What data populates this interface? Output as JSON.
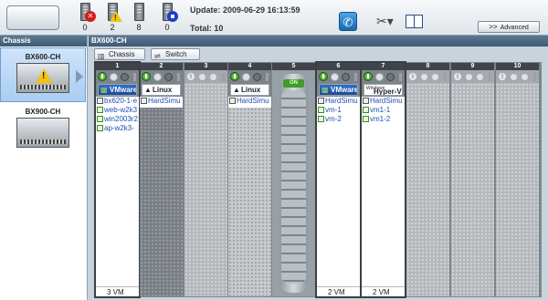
{
  "toolbar": {
    "counts": {
      "error": "0",
      "warning": "2",
      "normal": "8",
      "stopped": "0"
    },
    "update_text": "Update: 2009-06-29 16:13:59",
    "total_text": "Total: 10",
    "advanced_label": "Advanced",
    "advanced_arrow": ">>"
  },
  "left": {
    "title": "Chassis",
    "items": [
      {
        "name": "BX600-CH",
        "status": "warning",
        "selected": true
      },
      {
        "name": "BX900-CH",
        "status": "normal",
        "selected": false
      }
    ]
  },
  "right": {
    "title": "BX600-CH",
    "tabs": {
      "chassis": "Chassis",
      "switch": "Switch"
    },
    "slots": [
      {
        "num": "1",
        "os": "VMware",
        "vms": [
          "bx620-1-e",
          "web-w2k3",
          "win2003r2",
          "ap-w2k3-"
        ],
        "count": "3 VM"
      },
      {
        "num": "2",
        "os": "Linux",
        "vms": [
          "HardSimu"
        ]
      },
      {
        "num": "3"
      },
      {
        "num": "4",
        "os": "Linux",
        "vms": [
          "HardSimu"
        ]
      },
      {
        "num": "5",
        "on": "ON"
      },
      {
        "num": "6",
        "os": "VMware",
        "vms": [
          "HardSimu",
          "vm-1",
          "vm-2"
        ],
        "count": "2 VM"
      },
      {
        "num": "7",
        "os_small": "Windows",
        "os": "Hyper-V",
        "vms": [
          "HardSimu",
          "vm1-1",
          "vm1-2"
        ],
        "count": "2 VM"
      },
      {
        "num": "8"
      },
      {
        "num": "9"
      },
      {
        "num": "10"
      }
    ]
  },
  "colors": {
    "accent": "#3d5a74",
    "link": "#1f4fb4",
    "power_on": "#2d8d18",
    "warning": "#f4c20d",
    "error": "#d11c1c",
    "stop": "#1a3fc9"
  },
  "icons": {
    "error": "error-icon",
    "warning": "warning-icon",
    "normal": "server-icon",
    "stopped": "stop-icon",
    "help": "phone-help-icon",
    "tools": "tools-icon",
    "manual": "book-icon"
  }
}
